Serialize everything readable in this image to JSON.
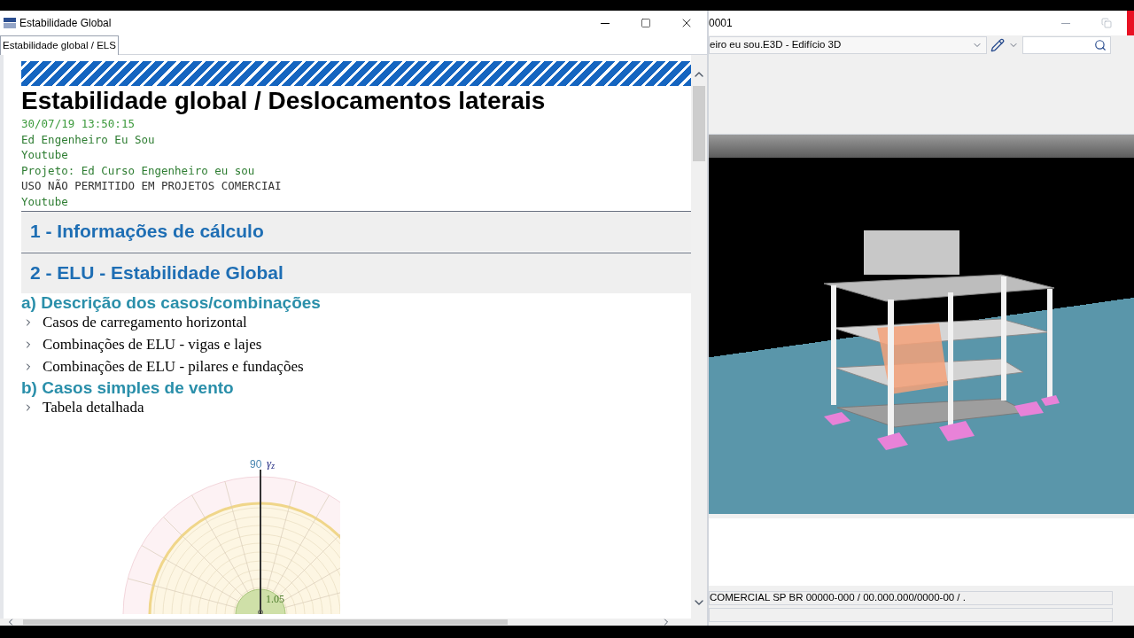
{
  "report_window": {
    "title": "Estabilidade Global",
    "tabs": [
      {
        "label": "Estabilidade global / ELS",
        "selected": true
      }
    ],
    "report": {
      "title": "Estabilidade global / Deslocamentos laterais",
      "info_lines": [
        {
          "text": "30/07/19 13:50:15",
          "color": "#3c9a3c"
        },
        {
          "text": "Ed Engenheiro Eu Sou",
          "color": "#2e7d32"
        },
        {
          "text": "Youtube",
          "color": "#2e7d32"
        },
        {
          "text": "Projeto: Ed Curso Engenheiro eu sou",
          "color": "#2e7d32"
        },
        {
          "text": "USO NÃO PERMITIDO EM PROJETOS COMERCIAI",
          "color": "#333333"
        },
        {
          "text": "Youtube",
          "color": "#2e7d32"
        }
      ],
      "sections": [
        {
          "title": "1 - Informações de cálculo"
        },
        {
          "title": "2 - ELU - Estabilidade Global"
        }
      ],
      "subsections": [
        {
          "title": "a) Descrição dos casos/combinações",
          "items": [
            {
              "label": "Casos de carregamento horizontal",
              "expanded": false
            },
            {
              "label": "Combinações de ELU - vigas e lajes",
              "expanded": false
            },
            {
              "label": "Combinações de ELU - pilares e fundações",
              "expanded": false
            }
          ]
        },
        {
          "title": "b) Casos simples de vento",
          "items": [
            {
              "label": "Tabela detalhada",
              "expanded": false
            }
          ]
        }
      ],
      "polar_diagram": {
        "angle_label": "90",
        "axis_label": "γ$_{z}$",
        "value_label": "1.05"
      }
    }
  },
  "model_window": {
    "title": "0001",
    "model_select": {
      "value": "eiro eu sou.E3D - Edifício 3D"
    },
    "status_lines": [
      "COMERCIAL SP BR 00000-000 / 00.000.000/0000-00 / ."
    ]
  }
}
